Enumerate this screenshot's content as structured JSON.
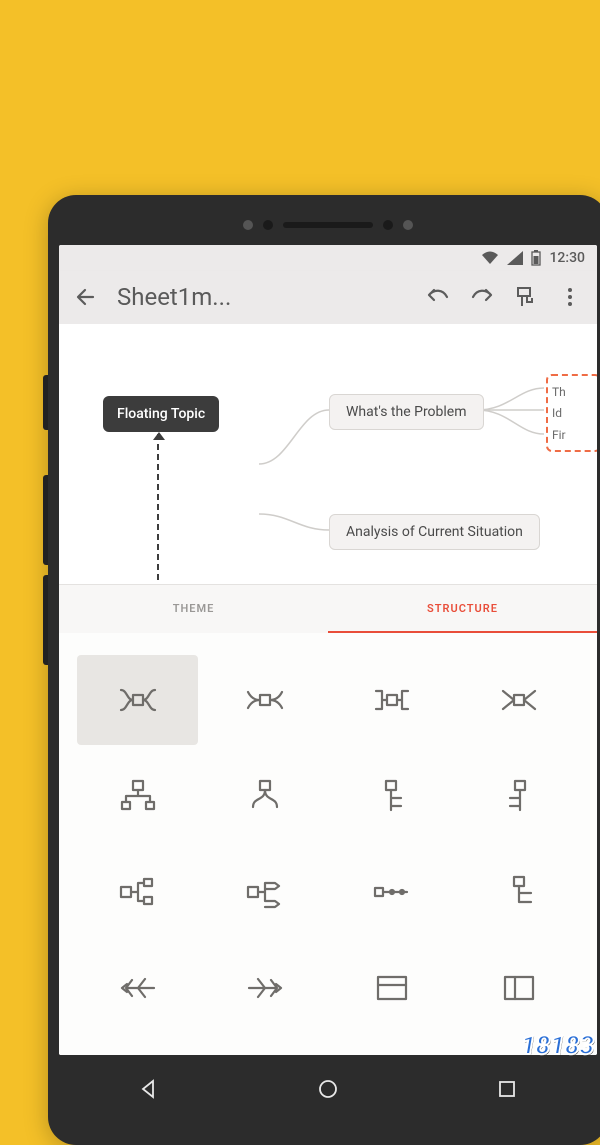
{
  "status": {
    "time": "12:30"
  },
  "toolbar": {
    "title": "Sheet1m..."
  },
  "canvas": {
    "floating_label": "Floating Topic",
    "node1": "What's the Problem",
    "node2": "Analysis of Current Situation",
    "side_lines": [
      "Th",
      "Id",
      "Fir"
    ]
  },
  "tabs": {
    "theme": "THEME",
    "structure": "STRUCTURE"
  },
  "watermark": "18183"
}
